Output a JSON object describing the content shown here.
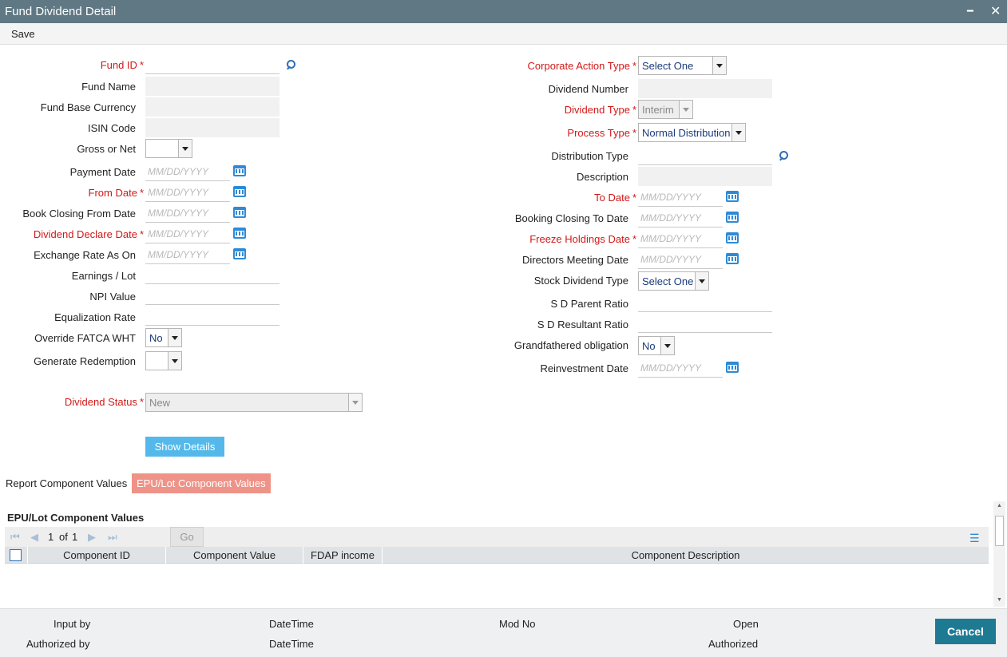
{
  "window": {
    "title": "Fund Dividend Detail",
    "minimize_glyph": "━",
    "close_glyph": "✕"
  },
  "menu": {
    "save_label": "Save"
  },
  "left": {
    "fund_id": {
      "label": "Fund ID",
      "value": ""
    },
    "fund_name": {
      "label": "Fund Name",
      "value": ""
    },
    "fund_base_currency": {
      "label": "Fund Base Currency",
      "value": ""
    },
    "isin_code": {
      "label": "ISIN Code",
      "value": ""
    },
    "gross_or_net": {
      "label": "Gross or Net",
      "value": ""
    },
    "payment_date": {
      "label": "Payment Date",
      "placeholder": "MM/DD/YYYY"
    },
    "from_date": {
      "label": "From Date",
      "placeholder": "MM/DD/YYYY"
    },
    "book_closing_from_date": {
      "label": "Book Closing From Date",
      "placeholder": "MM/DD/YYYY"
    },
    "dividend_declare_date": {
      "label": "Dividend Declare Date",
      "placeholder": "MM/DD/YYYY"
    },
    "exchange_rate_as_on": {
      "label": "Exchange Rate As On",
      "placeholder": "MM/DD/YYYY"
    },
    "earnings_lot": {
      "label": "Earnings / Lot",
      "value": ""
    },
    "npi_value": {
      "label": "NPI Value",
      "value": ""
    },
    "equalization_rate": {
      "label": "Equalization Rate",
      "value": ""
    },
    "override_fatca_wht": {
      "label": "Override FATCA WHT",
      "value": "No"
    },
    "generate_redemption": {
      "label": "Generate Redemption",
      "value": ""
    },
    "dividend_status": {
      "label": "Dividend Status",
      "value": "New"
    }
  },
  "right": {
    "corporate_action_type": {
      "label": "Corporate Action Type",
      "value": "Select One"
    },
    "dividend_number": {
      "label": "Dividend Number",
      "value": ""
    },
    "dividend_type": {
      "label": "Dividend Type",
      "value": "Interim"
    },
    "process_type": {
      "label": "Process Type",
      "value": "Normal Distribution"
    },
    "distribution_type": {
      "label": "Distribution Type",
      "value": ""
    },
    "description": {
      "label": "Description",
      "value": ""
    },
    "to_date": {
      "label": "To Date",
      "placeholder": "MM/DD/YYYY"
    },
    "booking_closing_to_date": {
      "label": "Booking Closing To Date",
      "placeholder": "MM/DD/YYYY"
    },
    "freeze_holdings_date": {
      "label": "Freeze Holdings Date",
      "placeholder": "MM/DD/YYYY"
    },
    "directors_meeting_date": {
      "label": "Directors Meeting Date",
      "placeholder": "MM/DD/YYYY"
    },
    "stock_dividend_type": {
      "label": "Stock Dividend Type",
      "value": "Select One"
    },
    "sd_parent_ratio": {
      "label": "S D Parent Ratio",
      "value": ""
    },
    "sd_resultant_ratio": {
      "label": "S D Resultant Ratio",
      "value": ""
    },
    "grandfathered_obligation": {
      "label": "Grandfathered obligation",
      "value": "No"
    },
    "reinvestment_date": {
      "label": "Reinvestment Date",
      "placeholder": "MM/DD/YYYY"
    }
  },
  "required_mark": "*",
  "show_details_label": "Show Details",
  "tabs": [
    {
      "label": "Report Component Values",
      "active": false
    },
    {
      "label": "EPU/Lot Component Values",
      "active": true
    }
  ],
  "grid": {
    "title": "EPU/Lot Component Values",
    "page_current": "1",
    "page_of": "of",
    "page_total": "1",
    "go_label": "Go",
    "columns": [
      "Component ID",
      "Component Value",
      "FDAP income",
      "Component Description"
    ],
    "rows": []
  },
  "footer": {
    "input_by": "Input by",
    "datetime_1": "DateTime",
    "mod_no": "Mod No",
    "open": "Open",
    "authorized_by": "Authorized by",
    "datetime_2": "DateTime",
    "authorized": "Authorized",
    "cancel_label": "Cancel"
  },
  "colors": {
    "titlebar": "#5f7883",
    "required": "#d21818",
    "show_details": "#54b9ea",
    "active_tab": "#ef9388",
    "cancel": "#1e7a93"
  },
  "icons": {
    "calendar": "calendar-icon",
    "lookup": "search-icon"
  }
}
